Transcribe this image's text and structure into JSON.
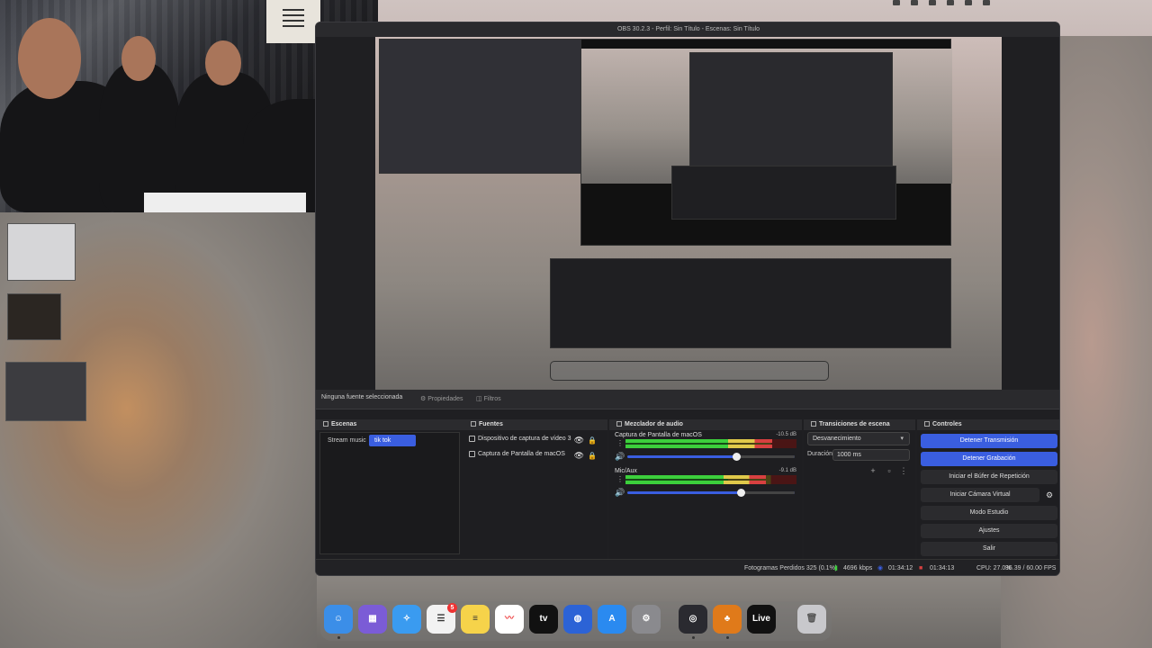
{
  "window_title": "OBS 30.2.3 - Perfil: Sin Título - Escenas: Sin Título",
  "toolbar": {
    "no_source": "Ninguna fuente seleccionada",
    "properties": "Propiedades",
    "filters": "Filtros"
  },
  "scenes": {
    "title": "Escenas",
    "items": [
      "Stream music",
      "tik tok"
    ]
  },
  "sources": {
    "title": "Fuentes",
    "items": [
      "Dispositivo de captura de vídeo 3",
      "Captura de Pantalla de macOS"
    ]
  },
  "mixer": {
    "title": "Mezclador de audio",
    "channels": [
      {
        "name": "Captura de Pantalla de macOS",
        "db": "-10.5 dB",
        "level": 0.86,
        "volume": 0.65
      },
      {
        "name": "Mic/Aux",
        "db": "-9.1 dB",
        "level": 0.82,
        "volume": 0.68
      }
    ]
  },
  "transitions": {
    "title": "Transiciones de escena",
    "selected": "Desvanecimiento",
    "duration_label": "Duración",
    "duration_value": "1000 ms"
  },
  "controls": {
    "title": "Controles",
    "stop_stream": "Detener Transmisión",
    "stop_recording": "Detener Grabación",
    "replay_buffer": "Iniciar el Búfer de Repetición",
    "virtual_cam": "Iniciar Cámara Virtual",
    "studio_mode": "Modo Estudio",
    "settings": "Ajustes",
    "exit": "Salir"
  },
  "status": {
    "dropped": "Fotogramas Perdidos 325 (0.1%)",
    "bitrate": "4696 kbps",
    "stream_time": "01:34:12",
    "rec_time": "01:34:13",
    "cpu": "CPU: 27.0%",
    "fps": "36.39 / 60.00 FPS"
  },
  "dock": {
    "live_label": "Live",
    "reminders_badge": "5",
    "appletv_label": "tv"
  },
  "colors": {
    "accent": "#3a5ee0",
    "panel_bg": "#1e1e21",
    "meter_green": "#3ccf3c",
    "meter_yellow": "#e0c94a",
    "meter_red": "#d84040"
  }
}
